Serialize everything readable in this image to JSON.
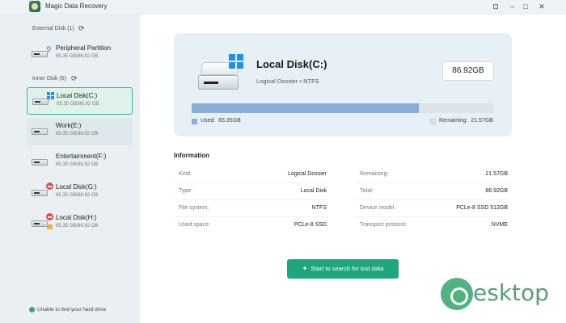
{
  "app": {
    "title": "Magic Data Recovery"
  },
  "window_controls": {
    "pin": "⊡",
    "minimize": "–",
    "maximize": "□",
    "close": "✕"
  },
  "sidebar": {
    "external_header": "External Disk (1)",
    "inner_header": "Inner Disk (6)",
    "external": [
      {
        "name": "Peripheral Partition",
        "size": "65.35 GB/86.92 GB"
      }
    ],
    "inner": [
      {
        "name": "Local Disk(C:)",
        "size": "65.35 GB/86.92 GB"
      },
      {
        "name": "Work(E:)",
        "size": "65.35 GB/86.92 GB"
      },
      {
        "name": "Entertainment(F:)",
        "size": "65.35 GB/86.92 GB"
      },
      {
        "name": "Local Disk(G:)",
        "size": "65.35 GB/86.92 GB"
      },
      {
        "name": "Local Disk(H:)",
        "size": "65.35 GB/86.92 GB"
      }
    ],
    "help": "Unable to find your hard drive"
  },
  "card": {
    "title": "Local Disk(C:)",
    "subtitle": "Logical Dossier • NTFS",
    "capacity": "86.92GB",
    "used_label": "Used:",
    "used_value": "65.35GB",
    "remaining_label": "Remaining:",
    "remaining_value": "21.57GB",
    "used_fraction": 0.752
  },
  "information": {
    "title": "Information",
    "left": [
      {
        "label": "Kind:",
        "value": "Logical Dossier"
      },
      {
        "label": "Type:",
        "value": "Local Disk"
      },
      {
        "label": "File system:",
        "value": "NTFS"
      },
      {
        "label": "Used space:",
        "value": "PCLe-8 SSD"
      }
    ],
    "right": [
      {
        "label": "Remaining:",
        "value": "21.57GB"
      },
      {
        "label": "Total:",
        "value": "86.92GB"
      },
      {
        "label": "Device model:",
        "value": "PCLe-8 SSD 512GB"
      },
      {
        "label": "Transport protocol:",
        "value": "NVME"
      }
    ]
  },
  "actions": {
    "scan": "Start to search for lost data"
  },
  "watermark": {
    "text": "esktop"
  },
  "colors": {
    "accent": "#1fa67d",
    "bar_used": "#8aaed8",
    "selected_border": "#39b88a"
  }
}
